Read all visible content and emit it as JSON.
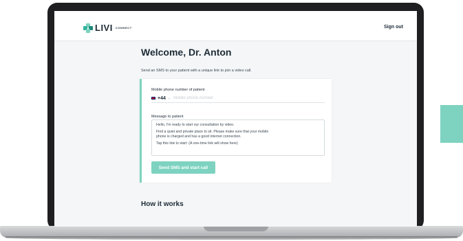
{
  "brand": {
    "name": "LIVI",
    "subname": "CONNECT"
  },
  "header": {
    "sign_out": "Sign out"
  },
  "main": {
    "title": "Welcome, Dr. Anton",
    "intro": "Send an SMS to your patient with a unique link to join a video call.",
    "phone": {
      "label": "Mobile phone number of patient",
      "country_code": "+44",
      "country_flag": "flag-uk-icon",
      "placeholder": "Mobile phone number",
      "value": ""
    },
    "message": {
      "label": "Message to patient",
      "lines": [
        "Hello, I'm ready to start our consultation by video.",
        "Find a quiet and private place to sit. Please make sure that your mobile",
        "phone is charged and has a good internet connection.",
        "Tap this link to start: (A one-time link will show here)"
      ]
    },
    "send_button": "Send SMS and start call",
    "how_it_works": "How it works"
  },
  "colors": {
    "accent": "#7dd3c0",
    "text": "#1d2b36",
    "background": "#f4f6f7",
    "decor_square": "#7dd3c0"
  }
}
